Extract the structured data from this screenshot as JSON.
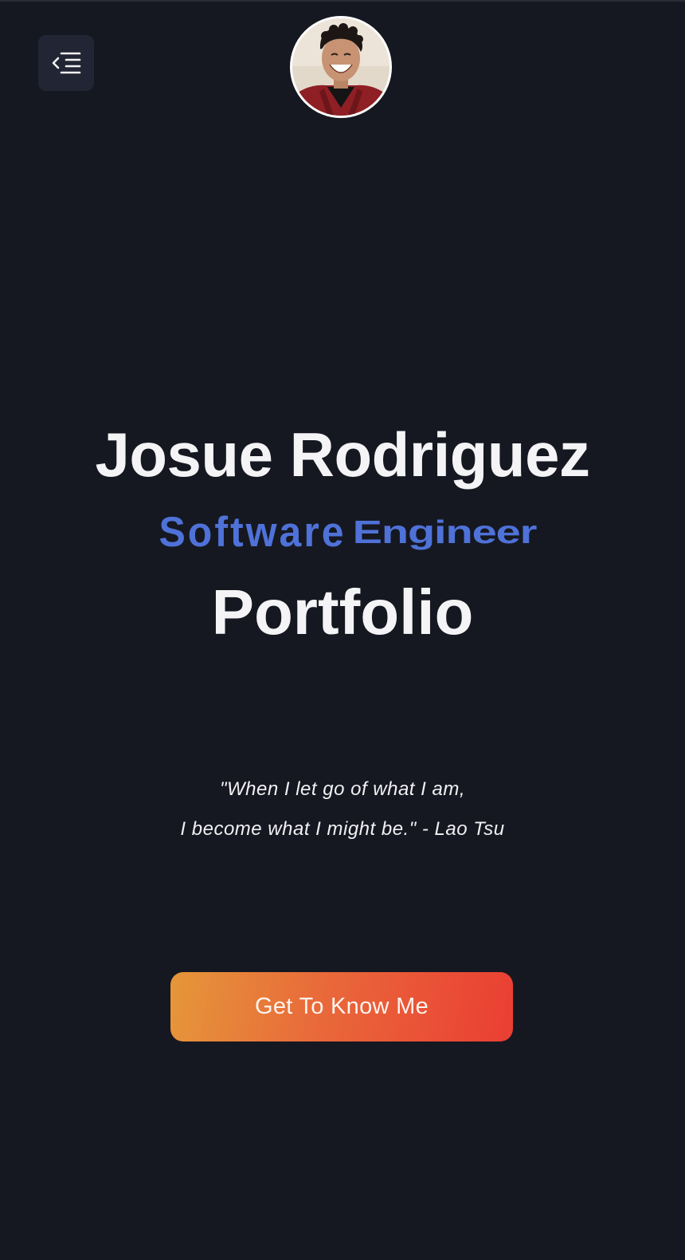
{
  "header": {
    "menu_icon": "menu-collapse-icon",
    "avatar_alt": "profile-photo"
  },
  "hero": {
    "name": "Josue Rodriguez",
    "role_word_1": "Software",
    "role_word_2": "Engineer",
    "title": "Portfolio"
  },
  "quote": {
    "line_1": "\"When I let go of what I am,",
    "line_2": "I become what I might be.\" - Lao Tsu"
  },
  "cta": {
    "label": "Get To Know Me"
  },
  "colors": {
    "background": "#161821",
    "accent_blue": "#4f72d8",
    "cta_gradient_start": "#e5973a",
    "cta_gradient_end": "#ea3e33",
    "text_primary": "#f4f4f6"
  }
}
